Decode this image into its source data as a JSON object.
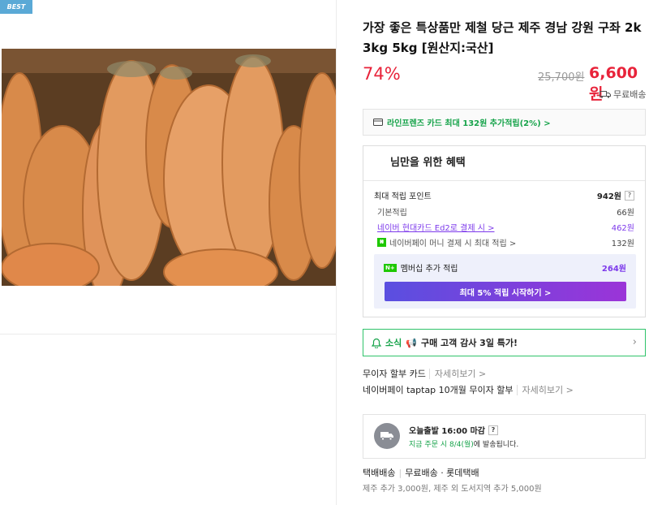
{
  "badge": "BEST",
  "product": {
    "title": "가장 좋은 특상품만 제철 당근 제주 경남 강원 구좌 2k 3kg 5kg [원산지:국산]",
    "discount": "74%",
    "original_price": "25,700원",
    "price": "6,600원",
    "free_shipping": "무료배송"
  },
  "card_promo": "라인프렌즈 카드 최대 132원 추가적립(2%) >",
  "benefits": {
    "heading": "님만을 위한 혜택",
    "max_points_label": "최대 적립 포인트",
    "max_points_value": "942원",
    "q": "?",
    "rows": [
      {
        "label": "기본적립",
        "value": "66원"
      },
      {
        "label": "네이버 현대카드 Ed2로 결제 시 >",
        "value": "462원"
      },
      {
        "label": "네이버페이 머니 결제 시 최대 적립 >",
        "value": "132원"
      }
    ],
    "member_label": "멤버십 추가 적립",
    "member_value": "264원",
    "member_badge": "N+",
    "member_button": "최대 5% 적립 시작하기 >"
  },
  "news": {
    "keyword": "소식",
    "text": "구매 고객 감사 3일 특가!"
  },
  "installments": [
    {
      "label": "무이자 할부 카드",
      "more": "자세히보기 >"
    },
    {
      "label": "네이버페이 taptap 10개월 무이자 할부",
      "more": "자세히보기 >"
    }
  ],
  "shipping": {
    "title": "오늘출발 16:00 마감",
    "q": "?",
    "sub_green": "지금 주문 시 8/4(월)",
    "sub_rest": "에 발송됩니다."
  },
  "delivery": {
    "type": "택배배송",
    "fee": "무료배송",
    "carrier": "· 롯데택배",
    "extra": "제주 추가 3,000원, 제주 외 도서지역 추가 5,000원"
  },
  "colors": {
    "accent_red": "#e8233a",
    "green": "#16a34a",
    "purple": "#7d3aeb"
  }
}
